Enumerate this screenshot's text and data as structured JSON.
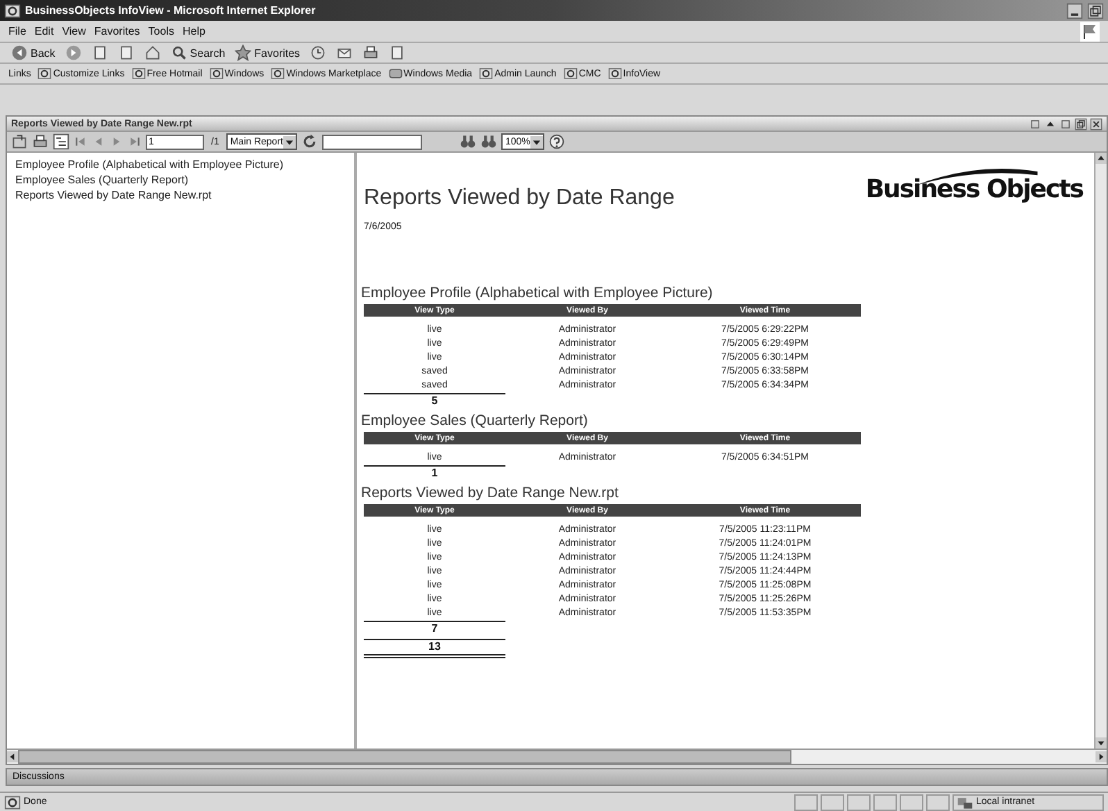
{
  "window": {
    "title": "BusinessObjects InfoView - Microsoft Internet Explorer"
  },
  "menu": [
    "File",
    "Edit",
    "View",
    "Favorites",
    "Tools",
    "Help"
  ],
  "toolbar": [
    {
      "kind": "back",
      "label": "Back"
    },
    {
      "kind": "forward"
    },
    {
      "kind": "page"
    },
    {
      "kind": "page"
    },
    {
      "kind": "home"
    },
    {
      "kind": "search",
      "label": "Search"
    },
    {
      "kind": "favorites",
      "label": "Favorites"
    },
    {
      "kind": "history"
    },
    {
      "kind": "mail"
    },
    {
      "kind": "print"
    },
    {
      "kind": "page"
    }
  ],
  "links": {
    "label": "Links",
    "items": [
      "Customize Links",
      "Free Hotmail",
      "Windows",
      "Windows Marketplace",
      "Windows Media",
      "Admin Launch",
      "CMC",
      "InfoView"
    ]
  },
  "frame": {
    "title": "Reports Viewed by Date Range New.rpt"
  },
  "report_toolbar": {
    "page": "1",
    "page_count": "/1",
    "view": "Main Report",
    "zoom": "100%"
  },
  "tree": {
    "items": [
      "Employee Profile (Alphabetical with Employee Picture)",
      "Employee Sales (Quarterly Report)",
      "Reports Viewed by Date Range New.rpt"
    ]
  },
  "report": {
    "title": "Reports Viewed by Date Range",
    "date": "7/6/2005",
    "logo": "Business Objects",
    "sections": [
      {
        "title": "Employee Profile (Alphabetical with Employee Picture)",
        "columns": [
          "View Type",
          "Viewed By",
          "Viewed Time"
        ],
        "count": "5",
        "rows": [
          [
            "live",
            "Administrator",
            "7/5/2005 6:29:22PM"
          ],
          [
            "live",
            "Administrator",
            "7/5/2005 6:29:49PM"
          ],
          [
            "live",
            "Administrator",
            "7/5/2005 6:30:14PM"
          ],
          [
            "saved",
            "Administrator",
            "7/5/2005 6:33:58PM"
          ],
          [
            "saved",
            "Administrator",
            "7/5/2005 6:34:34PM"
          ]
        ]
      },
      {
        "title": "Employee Sales (Quarterly Report)",
        "columns": [
          "View Type",
          "Viewed By",
          "Viewed Time"
        ],
        "count": "1",
        "rows": [
          [
            "live",
            "Administrator",
            "7/5/2005 6:34:51PM"
          ]
        ]
      },
      {
        "title": "Reports Viewed by Date Range New.rpt",
        "columns": [
          "View Type",
          "Viewed By",
          "Viewed Time"
        ],
        "count": "7",
        "rows": [
          [
            "live",
            "Administrator",
            "7/5/2005 11:23:11PM"
          ],
          [
            "live",
            "Administrator",
            "7/5/2005 11:24:01PM"
          ],
          [
            "live",
            "Administrator",
            "7/5/2005 11:24:13PM"
          ],
          [
            "live",
            "Administrator",
            "7/5/2005 11:24:44PM"
          ],
          [
            "live",
            "Administrator",
            "7/5/2005 11:25:08PM"
          ],
          [
            "live",
            "Administrator",
            "7/5/2005 11:25:26PM"
          ],
          [
            "live",
            "Administrator",
            "7/5/2005 11:53:35PM"
          ]
        ]
      }
    ],
    "total": "13"
  },
  "discussions": {
    "label": "Discussions"
  },
  "status_bar": {
    "text": "Done",
    "zone": "Local intranet"
  }
}
